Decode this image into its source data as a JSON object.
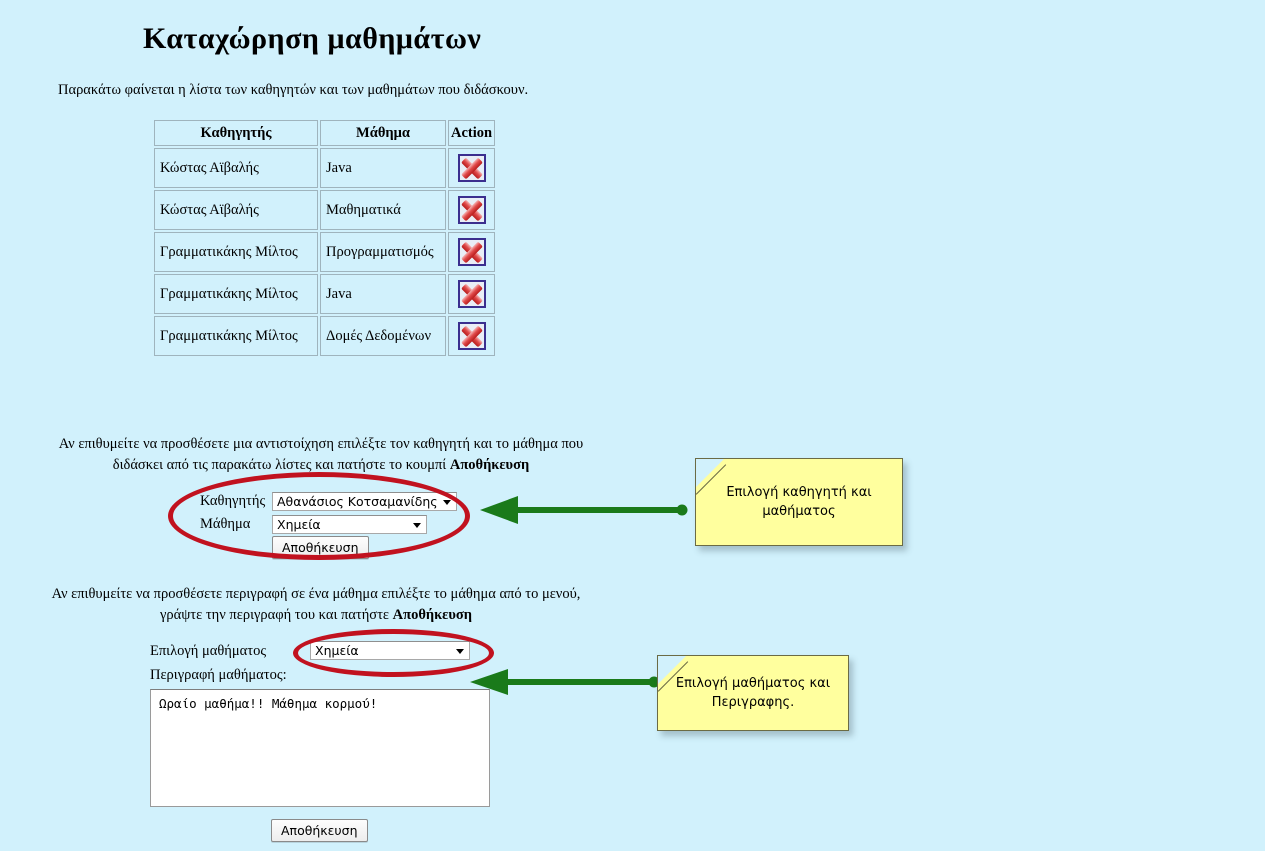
{
  "page": {
    "title": "Καταχώρηση μαθημάτων",
    "intro": "Παρακάτω φαίνεται η λίστα των καθηγητών και των μαθημάτων που διδάσκουν.",
    "background_color": "#d1f1fc"
  },
  "table": {
    "headers": [
      "Καθηγητής",
      "Μάθημα",
      "Action"
    ],
    "rows": [
      {
        "teacher": "Κώστας Αϊβαλής",
        "course": "Java",
        "action_icon": "delete-x-icon"
      },
      {
        "teacher": "Κώστας Αϊβαλής",
        "course": "Μαθηματικά",
        "action_icon": "delete-x-icon"
      },
      {
        "teacher": "Γραμματικάκης Μίλτος",
        "course": "Προγραμματισμός",
        "action_icon": "delete-x-icon"
      },
      {
        "teacher": "Γραμματικάκης Μίλτος",
        "course": "Java",
        "action_icon": "delete-x-icon"
      },
      {
        "teacher": "Γραμματικάκης Μίλτος",
        "course": "Δομές Δεδομένων",
        "action_icon": "delete-x-icon"
      }
    ]
  },
  "instructions": {
    "assign_line1": "Αν επιθυμείτε να προσθέσετε μια αντιστοίχηση επιλέξτε τον καθηγητή και το μάθημα που",
    "assign_line2_pre": "διδάσκει από τις παρακάτω λίστες και πατήστε το κουμπί ",
    "assign_line2_bold": "Αποθήκευση",
    "describe_line1": "Αν επιθυμείτε να προσθέσετε περιγραφή σε ένα μάθημα επιλέξτε το μάθημα από το μενού,",
    "describe_line2_pre": "γράψτε την περιγραφή του και πατήστε ",
    "describe_line2_bold": "Αποθήκευση"
  },
  "form_assign": {
    "teacher_label": "Καθηγητής",
    "teacher_selected": "Αθανάσιος Κοτσαμανίδης",
    "course_label": "Μάθημα",
    "course_selected": "Χημεία",
    "save_label": "Αποθήκευση"
  },
  "form_description": {
    "select_label": "Επιλογή μαθήματος",
    "course_selected": "Χημεία",
    "description_label": "Περιγραφή μαθήματος:",
    "description_value": "Ωραίο μαθήμα!! Μάθημα κορμού!",
    "save_label": "Αποθήκευση"
  },
  "annotations": {
    "note_1": "Επιλογή καθηγητή και μαθήματος",
    "note_2": "Επιλογή μαθήματος και Περιγραφης.",
    "ellipse_color": "#c1121f",
    "arrow_color": "#1a7a1a",
    "note_color": "#ffff9e"
  }
}
